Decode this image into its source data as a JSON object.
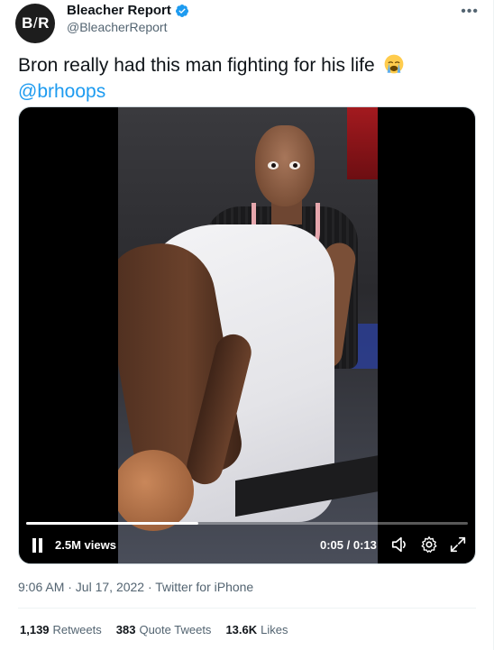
{
  "author": {
    "avatar_text_left": "B",
    "avatar_text_slash": "/",
    "avatar_text_right": "R",
    "display_name": "Bleacher Report",
    "handle": "@BleacherReport",
    "verified": true
  },
  "more_label": "•••",
  "tweet": {
    "text": "Bron really had this man fighting for his life",
    "emoji": "loudly-crying-face",
    "mention": "@brhoops"
  },
  "video": {
    "views": "2.5M views",
    "time": "0:05 / 0:13",
    "progress": 0.39
  },
  "meta": {
    "timestamp": "9:06 AM · Jul 17, 2022 · ",
    "source": "Twitter for iPhone"
  },
  "stats": {
    "retweets_count": "1,139",
    "retweets_label": "Retweets",
    "quotes_count": "383",
    "quotes_label": "Quote Tweets",
    "likes_count": "13.6K",
    "likes_label": "Likes"
  },
  "colors": {
    "link": "#1d9bf0",
    "secondary_text": "#536471",
    "verified": "#1d9bf0"
  }
}
